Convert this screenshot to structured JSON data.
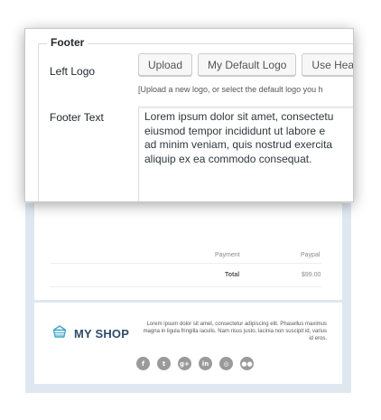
{
  "panel": {
    "legend": "Footer",
    "left_logo_label": "Left Logo",
    "buttons": {
      "upload": "Upload",
      "default_logo": "My Default Logo",
      "use_header": "Use Head"
    },
    "help_text": "[Upload a new logo, or select the default logo you h",
    "footer_text_label": "Footer Text",
    "footer_text_value": "Lorem ipsum dolor sit amet, consectetu\neiusmod tempor incididunt ut labore e\nad minim veniam, quis nostrud exercita\naliquip ex ea commodo consequat."
  },
  "email_preview": {
    "order_rows": [
      {
        "label": "Payment",
        "value": "Paypal"
      },
      {
        "label": "Total",
        "value": "$99.00"
      }
    ],
    "shop_name": "MY SHOP",
    "shop_description": "Lorem ipsum dolor sit amet, consectetur adipiscing elit. Phasellus maximus magna in ligula fringilla iaculis. Nam risus justo, lacinia non suscipit id, varius id eros.",
    "social_icons": [
      "facebook-icon",
      "twitter-icon",
      "google-plus-icon",
      "linkedin-icon",
      "instagram-icon",
      "flickr-icon"
    ],
    "social_glyphs": [
      "f",
      "t",
      "g+",
      "in",
      "◎",
      "●●"
    ],
    "colors": {
      "shop_name": "#2f4c6a",
      "frame": "#dfe8f0",
      "social_icon": "#9a9a9a"
    }
  }
}
